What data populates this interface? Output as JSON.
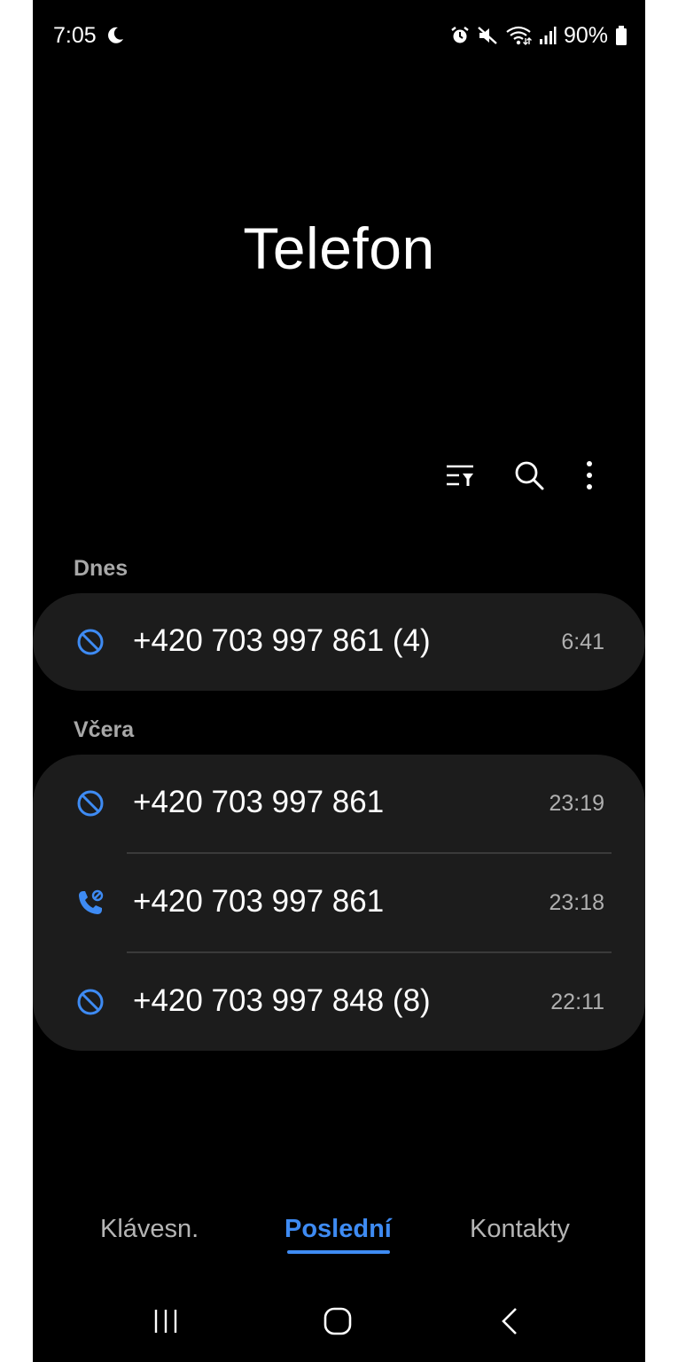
{
  "status_bar": {
    "time": "7:05",
    "battery": "90%",
    "icons": [
      "moon-icon",
      "alarm-icon",
      "mute-icon",
      "wifi-icon",
      "signal-icon",
      "battery-icon"
    ]
  },
  "header": {
    "title": "Telefon"
  },
  "toolbar": {
    "icons": [
      "filter-icon",
      "search-icon",
      "more-icon"
    ]
  },
  "sections": [
    {
      "label": "Dnes",
      "calls": [
        {
          "number": "+420 703 997 861 (4)",
          "time": "6:41",
          "type": "blocked-icon"
        }
      ]
    },
    {
      "label": "Včera",
      "calls": [
        {
          "number": "+420 703 997 861",
          "time": "23:19",
          "type": "blocked-icon"
        },
        {
          "number": "+420 703 997 861",
          "time": "23:18",
          "type": "call-icon"
        },
        {
          "number": "+420 703 997 848 (8)",
          "time": "22:11",
          "type": "blocked-icon"
        }
      ]
    }
  ],
  "tabs": [
    {
      "label": "Klávesn.",
      "active": false
    },
    {
      "label": "Poslední",
      "active": true
    },
    {
      "label": "Kontakty",
      "active": false
    }
  ],
  "nav": {
    "icons": [
      "recent-apps-icon",
      "home-icon",
      "back-icon"
    ]
  },
  "colors": {
    "accent": "#3e8bf3",
    "background": "#000000",
    "card": "#1c1c1c",
    "section_label": "#a8a8a8",
    "time_text": "#b0b0b0"
  }
}
